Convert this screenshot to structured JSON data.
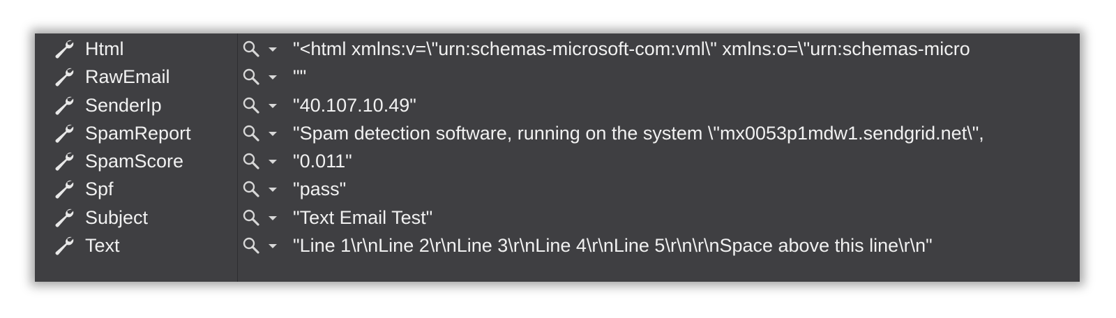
{
  "properties": [
    {
      "name": "Html",
      "value": "\"<html xmlns:v=\\\"urn:schemas-microsoft-com:vml\\\" xmlns:o=\\\"urn:schemas-micro"
    },
    {
      "name": "RawEmail",
      "value": "\"\""
    },
    {
      "name": "SenderIp",
      "value": "\"40.107.10.49\""
    },
    {
      "name": "SpamReport",
      "value": "\"Spam detection software, running on the system \\\"mx0053p1mdw1.sendgrid.net\\\", "
    },
    {
      "name": "SpamScore",
      "value": "\"0.011\""
    },
    {
      "name": "Spf",
      "value": "\"pass\""
    },
    {
      "name": "Subject",
      "value": "\"Text Email Test\""
    },
    {
      "name": "Text",
      "value": "\"Line 1\\r\\nLine 2\\r\\nLine 3\\r\\nLine 4\\r\\nLine 5\\r\\n\\r\\nSpace above this line\\r\\n\""
    }
  ],
  "icons": {
    "property": "wrench-icon",
    "visualizer": "magnifier-icon",
    "dropdown": "chevron-down-icon"
  },
  "colors": {
    "background": "#3f3f42",
    "text": "#f1f1f1",
    "icon": "#e8e8e8"
  }
}
